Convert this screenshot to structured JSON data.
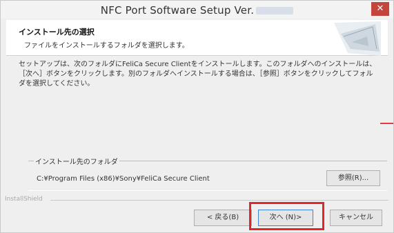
{
  "window": {
    "title": "NFC Port Software Setup  Ver.",
    "close_label": "✕"
  },
  "header": {
    "title": "インストール先の選択",
    "subtitle": "ファイルをインストールするフォルダを選択します。"
  },
  "body": {
    "text": "セットアップは、次のフォルダにFeliCa Secure Clientをインストールします。このフォルダへのインストールは、［次へ］ボタンをクリックします。別のフォルダへインストールする場合は、［参照］ボタンをクリックしてフォルダを選択してください。"
  },
  "destination": {
    "group_label": "インストール先のフォルダ",
    "path": "C:¥Program Files (x86)¥Sony¥FeliCa Secure Client",
    "browse_label": "参照(R)..."
  },
  "footer": {
    "installshield_label": "InstallShield",
    "back_label": "< 戻る(B)",
    "next_label": "次へ (N)>",
    "cancel_label": "キャンセル"
  },
  "colors": {
    "highlight": "#e02626",
    "close_button": "#c4453c"
  }
}
